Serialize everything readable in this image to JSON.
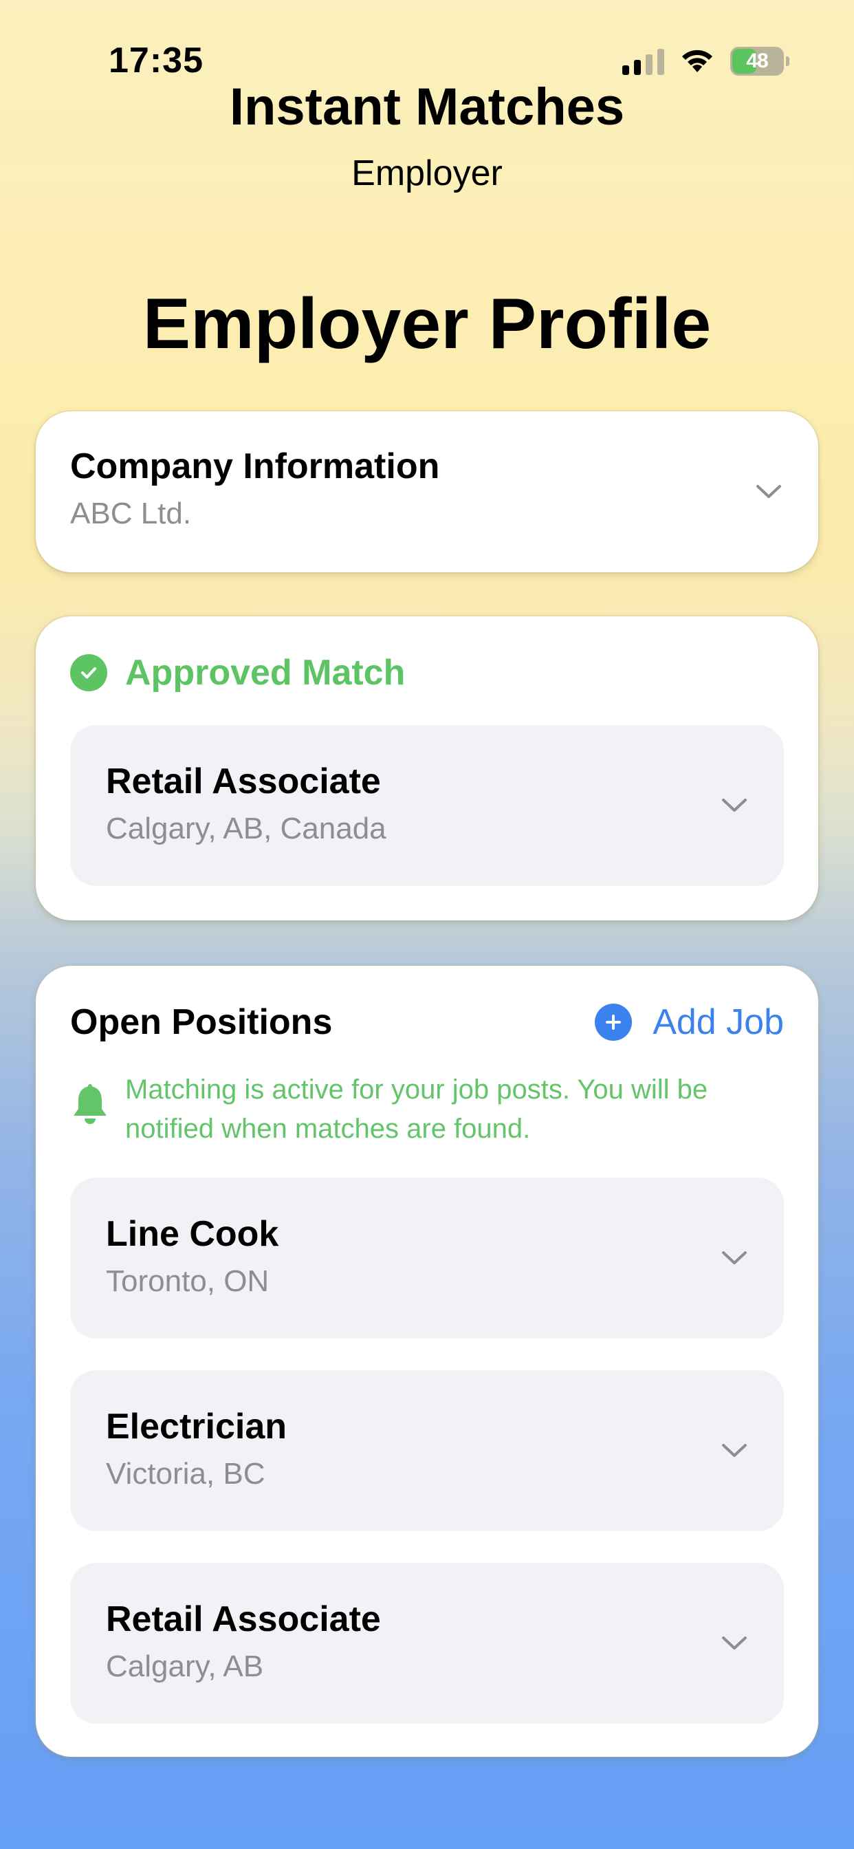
{
  "status_bar": {
    "time": "17:35",
    "battery": "48",
    "battery_level": 0.48,
    "icons": [
      "signal-icon",
      "wifi-icon",
      "battery-icon"
    ]
  },
  "header": {
    "app_title": "Instant Matches",
    "role": "Employer",
    "page_title": "Employer Profile"
  },
  "company": {
    "heading": "Company Information",
    "name": "ABC Ltd."
  },
  "approved": {
    "label": "Approved Match",
    "job": {
      "title": "Retail Associate",
      "location": "Calgary, AB, Canada"
    }
  },
  "positions": {
    "heading": "Open Positions",
    "add_label": "Add Job",
    "notice": "Matching is active for your job posts. You will be notified when matches are found.",
    "items": [
      {
        "title": "Line Cook",
        "location": "Toronto, ON"
      },
      {
        "title": "Electrician",
        "location": "Victoria, BC"
      },
      {
        "title": "Retail Associate",
        "location": "Calgary, AB"
      }
    ]
  },
  "colors": {
    "approved_green": "#5cc463",
    "link_blue": "#3b82ee",
    "secondary_text": "#8d8d92",
    "job_box_bg": "#f1f1f6"
  }
}
